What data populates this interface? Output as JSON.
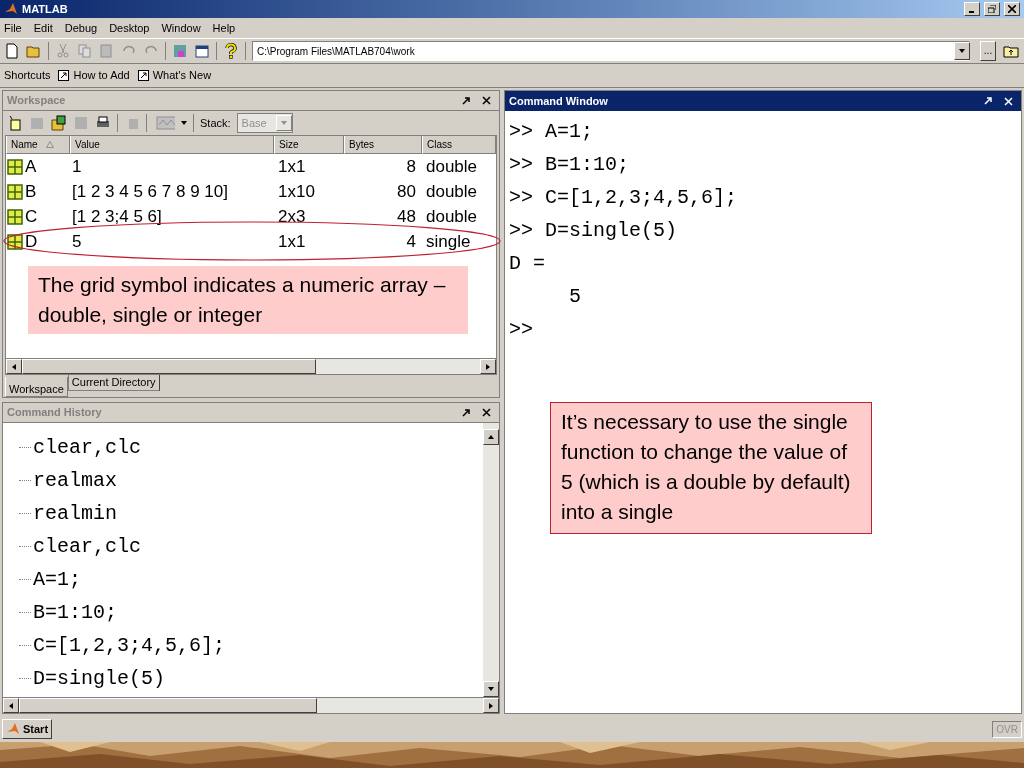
{
  "window": {
    "title": "MATLAB"
  },
  "menu": [
    "File",
    "Edit",
    "Debug",
    "Desktop",
    "Window",
    "Help"
  ],
  "toolbar": {
    "current_directory": "C:\\Program Files\\MATLAB704\\work",
    "browse_label": "..."
  },
  "shortcuts": {
    "label": "Shortcuts",
    "items": [
      "How to Add",
      "What's New"
    ]
  },
  "workspace": {
    "title": "Workspace",
    "stack_label": "Stack:",
    "stack_value": "Base",
    "columns": [
      "Name",
      "Value",
      "Size",
      "Bytes",
      "Class"
    ],
    "rows": [
      {
        "name": "A",
        "value": "1",
        "size": "1x1",
        "bytes": "8",
        "class": "double",
        "circled": false
      },
      {
        "name": "B",
        "value": "[1 2 3 4 5 6 7 8 9 10]",
        "size": "1x10",
        "bytes": "80",
        "class": "double",
        "circled": false
      },
      {
        "name": "C",
        "value": "[1 2 3;4 5 6]",
        "size": "2x3",
        "bytes": "48",
        "class": "double",
        "circled": false
      },
      {
        "name": "D",
        "value": "5",
        "size": "1x1",
        "bytes": "4",
        "class": "single",
        "circled": true
      }
    ],
    "callout": "The grid symbol indicates a numeric array – double, single or integer",
    "tabs": [
      {
        "label": "Workspace",
        "selected": true
      },
      {
        "label": "Current Directory",
        "selected": false
      }
    ]
  },
  "command_history": {
    "title": "Command History",
    "lines": [
      "clear,clc",
      "realmax",
      "realmin",
      "clear,clc",
      "A=1;",
      "B=1:10;",
      "C=[1,2,3;4,5,6];",
      "D=single(5)"
    ]
  },
  "command_window": {
    "title": "Command Window",
    "lines": [
      ">> A=1;",
      ">> B=1:10;",
      ">> C=[1,2,3;4,5,6];",
      ">> D=single(5)",
      "D =",
      "     5",
      ">>"
    ],
    "callout": "It’s necessary to use the single function to change the value of 5 (which is a double by default) into a single"
  },
  "status_bar": {
    "start": "Start",
    "mode": "OVR"
  }
}
